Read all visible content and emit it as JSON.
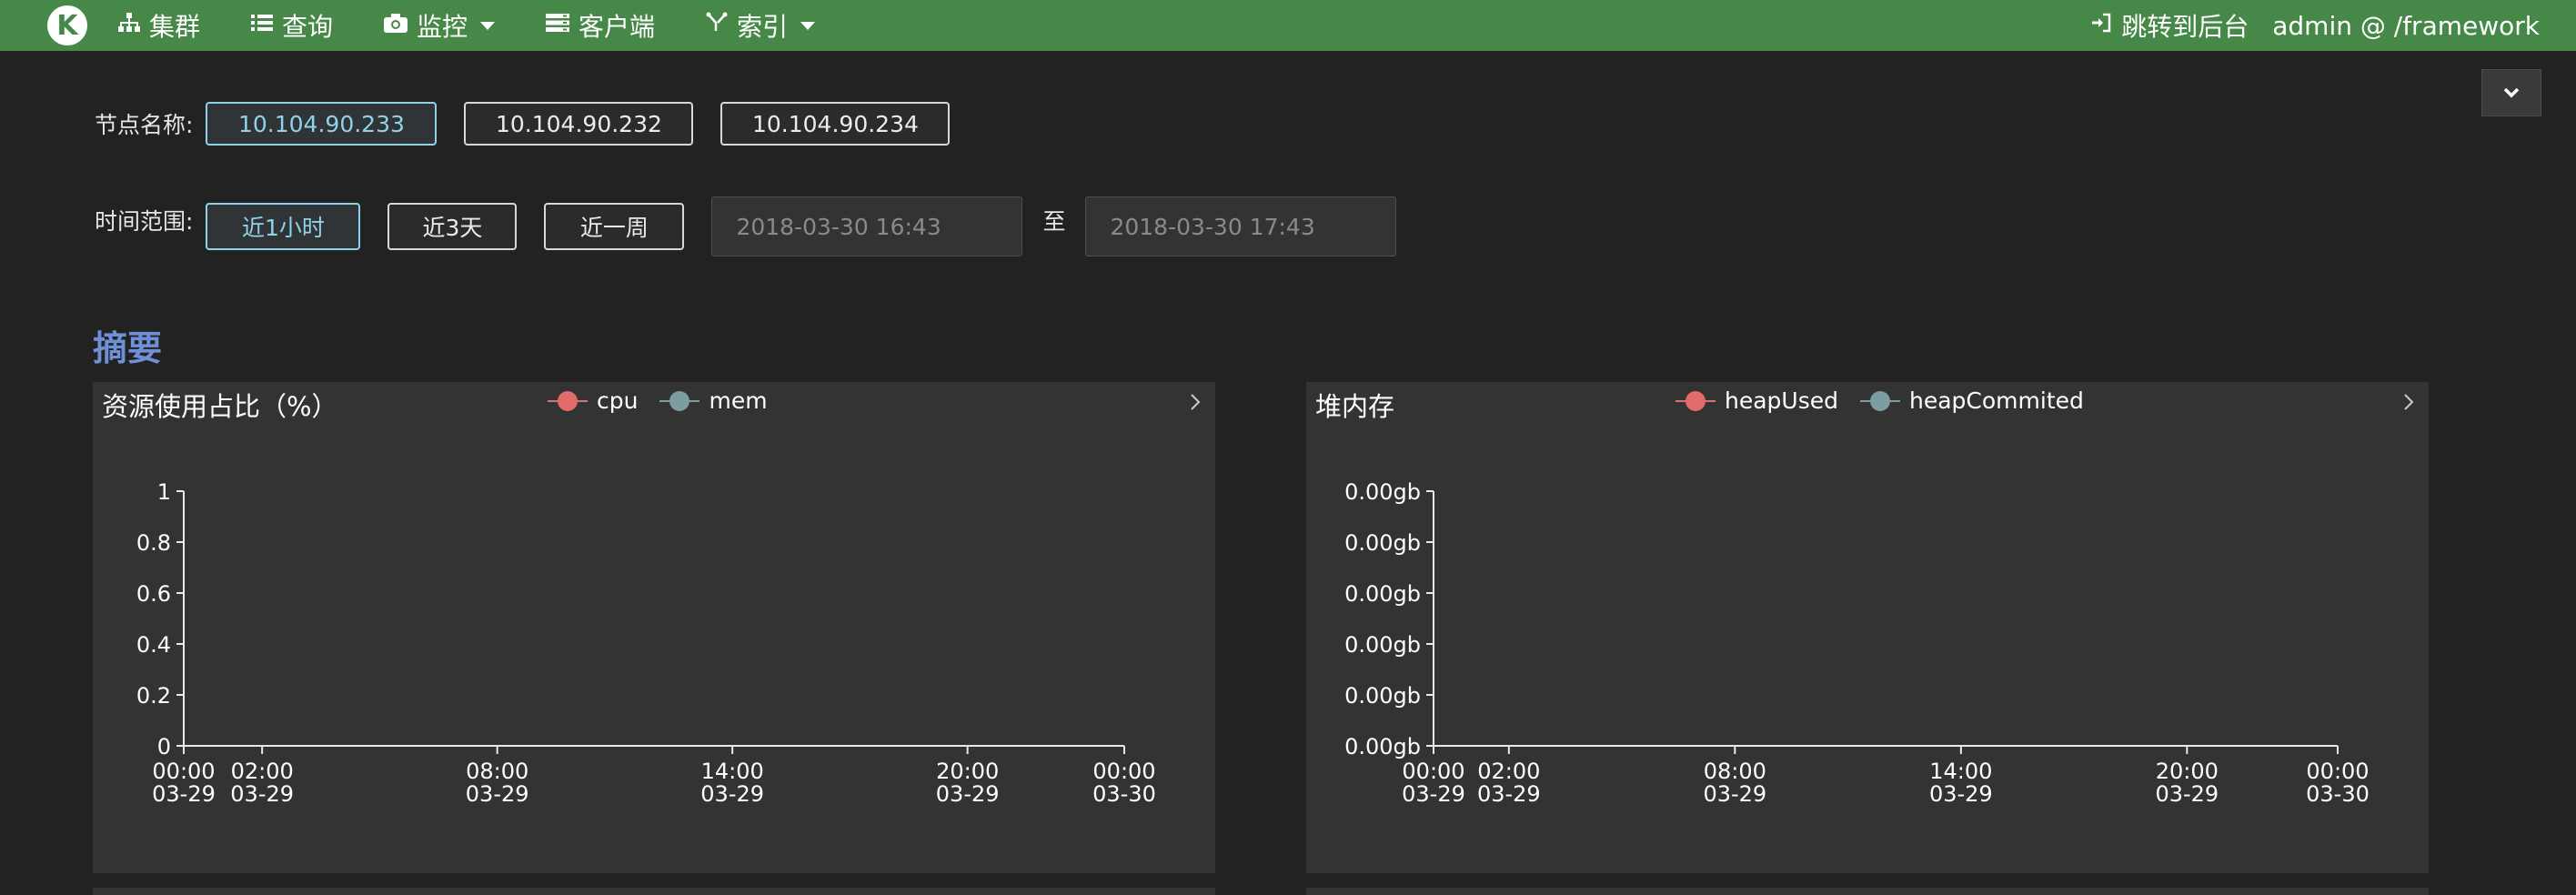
{
  "nav": {
    "logo": "K",
    "items": [
      {
        "label": "集群",
        "icon": "sitemap-icon",
        "dropdown": false
      },
      {
        "label": "查询",
        "icon": "list-icon",
        "dropdown": false
      },
      {
        "label": "监控",
        "icon": "camera-icon",
        "dropdown": true
      },
      {
        "label": "客户端",
        "icon": "server-icon",
        "dropdown": false
      },
      {
        "label": "索引",
        "icon": "filter-icon",
        "dropdown": true
      }
    ],
    "jump_label": "跳转到后台",
    "user_label": "admin @ /framework",
    "bar_color": "#468847"
  },
  "filters": {
    "node_label": "节点名称:",
    "nodes": [
      "10.104.90.233",
      "10.104.90.232",
      "10.104.90.234"
    ],
    "selected_node": "10.104.90.233",
    "time_label": "时间范围:",
    "ranges": [
      "近1小时",
      "近3天",
      "近一周"
    ],
    "selected_range": "近1小时",
    "start_time": "2018-03-30 16:43",
    "to_label": "至",
    "end_time": "2018-03-30 17:43",
    "active_color": "#8fd3e8"
  },
  "section_title": "摘要",
  "chart_data": [
    {
      "type": "line",
      "title": "资源使用占比（%）",
      "series": [
        {
          "name": "cpu",
          "color": "#e06c6c",
          "values": []
        },
        {
          "name": "mem",
          "color": "#7d9ea0",
          "values": []
        }
      ],
      "x_ticks": [
        {
          "t": 0,
          "label": [
            "00:00",
            "03-29"
          ]
        },
        {
          "t": 2,
          "label": [
            "02:00",
            "03-29"
          ]
        },
        {
          "t": 8,
          "label": [
            "08:00",
            "03-29"
          ]
        },
        {
          "t": 14,
          "label": [
            "14:00",
            "03-29"
          ]
        },
        {
          "t": 20,
          "label": [
            "20:00",
            "03-29"
          ]
        },
        {
          "t": 24,
          "label": [
            "00:00",
            "03-30"
          ]
        }
      ],
      "xlim": [
        0,
        24
      ],
      "y_ticks": [
        {
          "v": 0,
          "label": "0"
        },
        {
          "v": 0.2,
          "label": "0.2"
        },
        {
          "v": 0.4,
          "label": "0.4"
        },
        {
          "v": 0.6,
          "label": "0.6"
        },
        {
          "v": 0.8,
          "label": "0.8"
        },
        {
          "v": 1,
          "label": "1"
        }
      ],
      "ylim": [
        0,
        1
      ],
      "grid": false,
      "legend_position": "top-center"
    },
    {
      "type": "line",
      "title": "堆内存",
      "series": [
        {
          "name": "heapUsed",
          "color": "#e06c6c",
          "values": []
        },
        {
          "name": "heapCommited",
          "color": "#7d9ea0",
          "values": []
        }
      ],
      "x_ticks": [
        {
          "t": 0,
          "label": [
            "00:00",
            "03-29"
          ]
        },
        {
          "t": 2,
          "label": [
            "02:00",
            "03-29"
          ]
        },
        {
          "t": 8,
          "label": [
            "08:00",
            "03-29"
          ]
        },
        {
          "t": 14,
          "label": [
            "14:00",
            "03-29"
          ]
        },
        {
          "t": 20,
          "label": [
            "20:00",
            "03-29"
          ]
        },
        {
          "t": 24,
          "label": [
            "00:00",
            "03-30"
          ]
        }
      ],
      "xlim": [
        0,
        24
      ],
      "y_ticks": [
        {
          "v": 0,
          "label": "0.00gb"
        },
        {
          "v": 0.2,
          "label": "0.00gb"
        },
        {
          "v": 0.4,
          "label": "0.00gb"
        },
        {
          "v": 0.6,
          "label": "0.00gb"
        },
        {
          "v": 0.8,
          "label": "0.00gb"
        },
        {
          "v": 1,
          "label": "0.00gb"
        }
      ],
      "ylim": [
        0,
        1
      ],
      "grid": false,
      "legend_position": "top-center"
    }
  ]
}
